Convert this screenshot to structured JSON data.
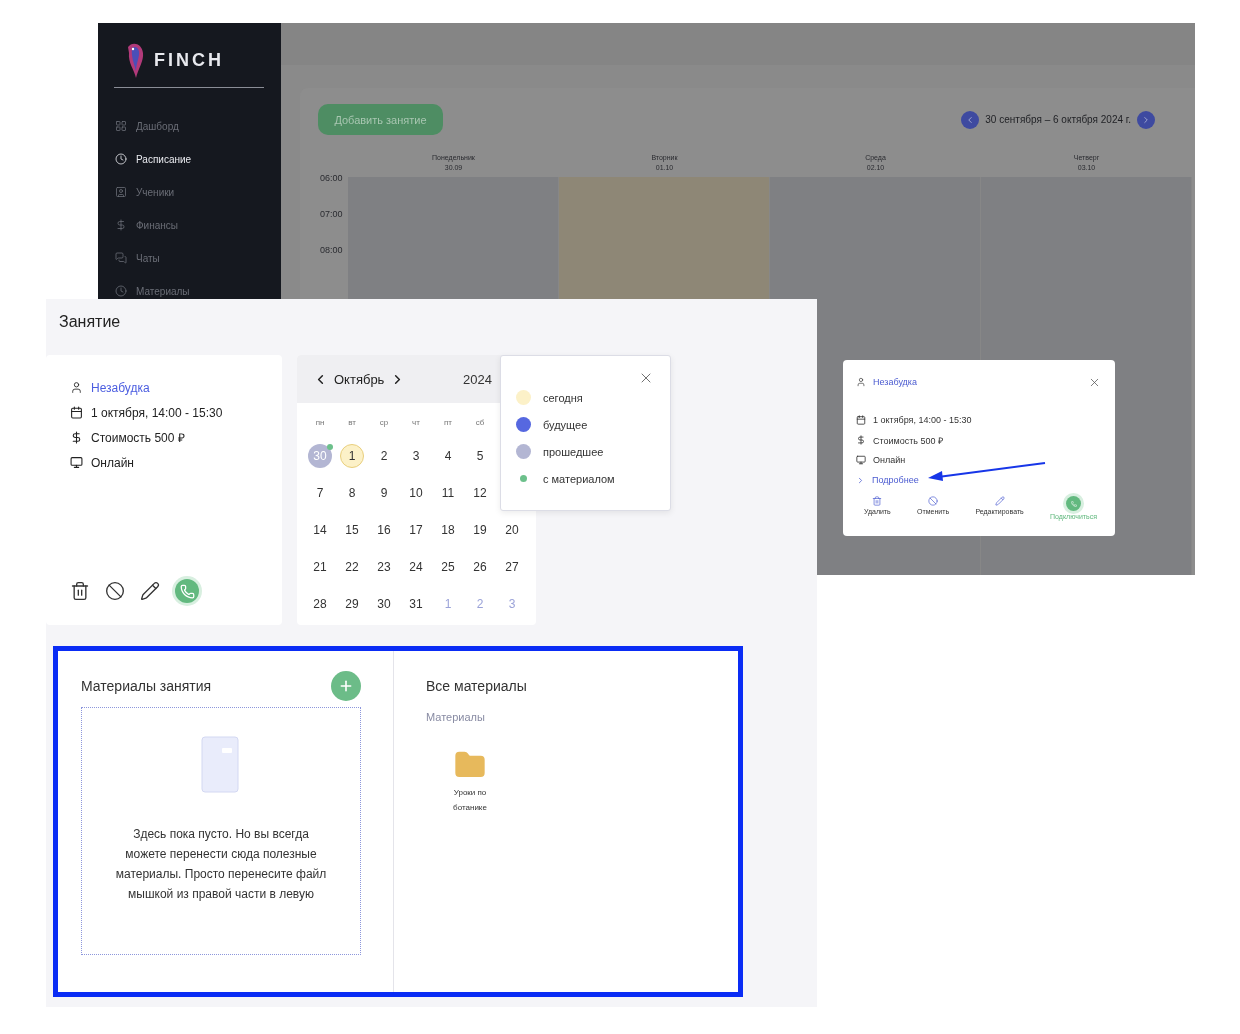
{
  "background_app": {
    "logo": "FINCH",
    "sidebar": {
      "items": [
        {
          "label": "Дашборд",
          "selected": false
        },
        {
          "label": "Расписание",
          "selected": true
        },
        {
          "label": "Ученики",
          "selected": false
        },
        {
          "label": "Финансы",
          "selected": false
        },
        {
          "label": "Чаты",
          "selected": false
        },
        {
          "label": "Материалы",
          "selected": false
        }
      ]
    },
    "add_button": "Добавить занятие",
    "week_range": "30 сентября – 6 октября 2024 г.",
    "days": [
      {
        "name": "Понедельник",
        "date": "30.09",
        "today": false
      },
      {
        "name": "Вторник",
        "date": "01.10",
        "today": true
      },
      {
        "name": "Среда",
        "date": "02.10",
        "today": false
      },
      {
        "name": "Четверг",
        "date": "03.10",
        "today": false
      }
    ],
    "hours": [
      "06:00",
      "07:00",
      "08:00"
    ],
    "popup": {
      "student": "Незабудка",
      "datetime": "1 октября, 14:00 - 15:30",
      "price": "Стоимость 500 ₽",
      "format": "Онлайн",
      "more": "Подробнее",
      "actions": [
        {
          "label": "Удалить",
          "kind": "delete"
        },
        {
          "label": "Отменить",
          "kind": "cancel"
        },
        {
          "label": "Редактировать",
          "kind": "edit"
        },
        {
          "label": "Подключиться",
          "kind": "connect"
        }
      ]
    }
  },
  "lesson_panel": {
    "title": "Занятие",
    "info": {
      "student": "Незабудка",
      "datetime": "1 октября, 14:00 - 15:30",
      "price": "Стоимость 500 ₽",
      "format": "Онлайн"
    },
    "actions": [
      {
        "kind": "delete"
      },
      {
        "kind": "cancel"
      },
      {
        "kind": "edit"
      },
      {
        "kind": "connect"
      }
    ],
    "calendar": {
      "month": "Октябрь",
      "year": "2024",
      "weekdays": [
        "пн",
        "вт",
        "ср",
        "чт",
        "пт",
        "сб"
      ],
      "weeks": [
        [
          {
            "day": "30",
            "kind": "past",
            "material": true
          },
          {
            "day": "1",
            "kind": "today",
            "material": false
          },
          {
            "day": "2",
            "kind": "normal",
            "material": false
          },
          {
            "day": "3",
            "kind": "normal",
            "material": false
          },
          {
            "day": "4",
            "kind": "normal",
            "material": false
          },
          {
            "day": "5",
            "kind": "normal",
            "material": false
          }
        ],
        [
          {
            "day": "7",
            "kind": "normal",
            "material": false
          },
          {
            "day": "8",
            "kind": "normal",
            "material": false
          },
          {
            "day": "9",
            "kind": "normal",
            "material": false
          },
          {
            "day": "10",
            "kind": "normal",
            "material": false
          },
          {
            "day": "11",
            "kind": "normal",
            "material": false
          },
          {
            "day": "12",
            "kind": "normal",
            "material": false
          }
        ],
        [
          {
            "day": "14",
            "kind": "normal",
            "material": false
          },
          {
            "day": "15",
            "kind": "normal",
            "material": false
          },
          {
            "day": "16",
            "kind": "normal",
            "material": false
          },
          {
            "day": "17",
            "kind": "normal",
            "material": false
          },
          {
            "day": "18",
            "kind": "normal",
            "material": false
          },
          {
            "day": "19",
            "kind": "normal",
            "material": false
          },
          {
            "day": "20",
            "kind": "normal",
            "material": false
          }
        ],
        [
          {
            "day": "21",
            "kind": "normal",
            "material": false
          },
          {
            "day": "22",
            "kind": "normal",
            "material": false
          },
          {
            "day": "23",
            "kind": "normal",
            "material": false
          },
          {
            "day": "24",
            "kind": "normal",
            "material": false
          },
          {
            "day": "25",
            "kind": "normal",
            "material": false
          },
          {
            "day": "26",
            "kind": "normal",
            "material": false
          },
          {
            "day": "27",
            "kind": "normal",
            "material": false
          }
        ],
        [
          {
            "day": "28",
            "kind": "normal",
            "material": false
          },
          {
            "day": "29",
            "kind": "normal",
            "material": false
          },
          {
            "day": "30",
            "kind": "normal",
            "material": false
          },
          {
            "day": "31",
            "kind": "normal",
            "material": false
          },
          {
            "day": "1",
            "kind": "outside",
            "material": false
          },
          {
            "day": "2",
            "kind": "outside",
            "material": false
          },
          {
            "day": "3",
            "kind": "outside",
            "material": false
          }
        ]
      ]
    },
    "legend": {
      "items": [
        {
          "label": "сегодня",
          "color": "#fcf1c8",
          "kind": "large"
        },
        {
          "label": "будущее",
          "color": "#5668e0",
          "kind": "large"
        },
        {
          "label": "прошедшее",
          "color": "#b3b6d3",
          "kind": "large"
        },
        {
          "label": "с материалом",
          "color": "#6cc08b",
          "kind": "small"
        }
      ]
    },
    "materials": {
      "title": "Материалы занятия",
      "empty_text": "Здесь пока пусто. Но вы всегда можете перенести сюда полезные материалы. Просто перенесите файл мышкой из правой части в левую",
      "all_title": "Все материалы",
      "section": "Материалы",
      "folders": [
        {
          "name": "Уроки по ботанике"
        }
      ]
    }
  }
}
